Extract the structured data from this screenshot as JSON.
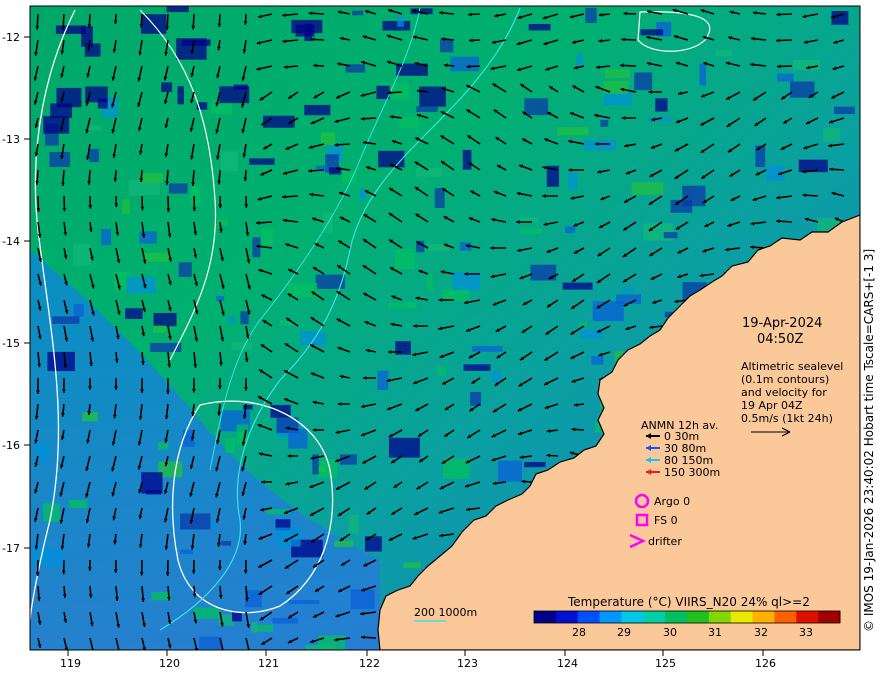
{
  "map": {
    "date": "19-Apr-2024",
    "time": "04:50Z",
    "altimetry_note": [
      "Altimetric sealevel",
      "(0.1m contours)",
      "and velocity for",
      "19 Apr 04Z",
      "0.5m/s (1kt 24h)"
    ],
    "legend": {
      "title": "ANMN 12h av.",
      "items": [
        {
          "label": "0 30m",
          "color": "#000000"
        },
        {
          "label": "30 80m",
          "color": "#1f4fff"
        },
        {
          "label": "80 150m",
          "color": "#15c3ff"
        },
        {
          "label": "150 300m",
          "color": "#e8210c"
        }
      ],
      "argo": "Argo 0",
      "fs": "FS 0",
      "drifter": "drifter",
      "marker_color": "#ff00ff"
    },
    "depth_label": "200  1000m",
    "colorbar": {
      "title": "Temperature (°C) VIIRS_N20 24% ql>=2",
      "ticks": [
        "28",
        "29",
        "30",
        "31",
        "32",
        "33"
      ],
      "colors": [
        "#00008b",
        "#0010d0",
        "#0050ff",
        "#0098ff",
        "#00c8e8",
        "#00d0a8",
        "#00c060",
        "#20c020",
        "#80d800",
        "#e8e800",
        "#ffb000",
        "#ff6000",
        "#e01000",
        "#a00000"
      ]
    },
    "x_ticks": [
      "119",
      "120",
      "121",
      "122",
      "123",
      "124",
      "125",
      "126"
    ],
    "y_ticks": [
      "-12",
      "-13",
      "-14",
      "-15",
      "-16",
      "-17"
    ],
    "side_caption": "© IMOS 19-Jan-2026 23:40:02 Hobart time Tscale=CARS+[-1 3]",
    "colors": {
      "land": "#fbc89a",
      "ocean": "#0a78e0",
      "contour": "#ffffff",
      "isobath": "#3de0e0"
    }
  }
}
